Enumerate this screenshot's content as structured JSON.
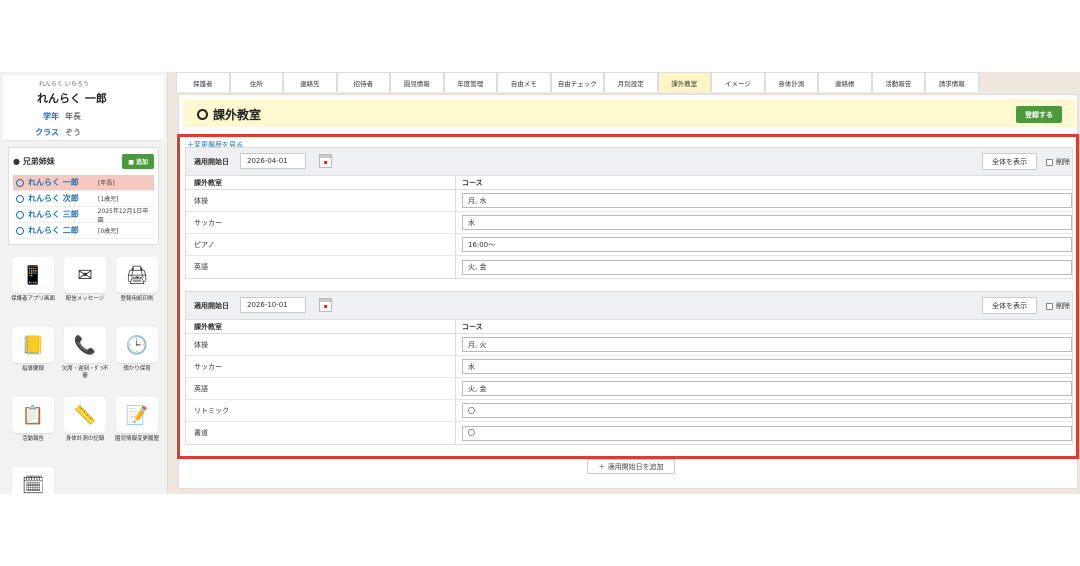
{
  "student": {
    "kana": "れんらく いちろう",
    "name": "れんらく 一郎",
    "grade_label": "学年",
    "grade_value": "年長",
    "class_label": "クラス",
    "class_value": "ぞう"
  },
  "siblings": {
    "title": "兄弟姉妹",
    "add_label": "追加",
    "items": [
      {
        "name": "れんらく 一郎",
        "tag": "[年長]"
      },
      {
        "name": "れんらく 次郎",
        "tag": "[1歳児]"
      },
      {
        "name": "れんらく 三郎",
        "tag": "2025年12月1日卒園"
      },
      {
        "name": "れんらく 二郎",
        "tag": "[0歳児]"
      }
    ]
  },
  "menu": [
    {
      "label": "保護者アプリ画面",
      "icon": "smartphone-icon",
      "glyph": "📱"
    },
    {
      "label": "配信メッセージ",
      "icon": "envelope-icon",
      "glyph": "✉"
    },
    {
      "label": "登録用紙印刷",
      "icon": "printer-icon",
      "glyph": "🖨"
    },
    {
      "label": "指導要録",
      "icon": "notebook-icon",
      "glyph": "📒"
    },
    {
      "label": "欠席・遅刻・ﾀﾞﾖ不審",
      "icon": "phone-icon",
      "glyph": "📞"
    },
    {
      "label": "預かり保育",
      "icon": "clock-icon",
      "glyph": "🕒"
    },
    {
      "label": "活動報告",
      "icon": "clipboard-icon",
      "glyph": "📋"
    },
    {
      "label": "身体計測の記録",
      "icon": "scale-icon",
      "glyph": "📏"
    },
    {
      "label": "園児情報変更履歴",
      "icon": "history-note-icon",
      "glyph": "📝"
    },
    {
      "label": "",
      "icon": "clock-edit-icon",
      "glyph": "🗓"
    }
  ],
  "tabs": [
    "保護者",
    "住所",
    "連絡先",
    "招待者",
    "園児情報",
    "年度管理",
    "自由メモ",
    "自由チェック",
    "月別設定",
    "課外教室",
    "イメージ",
    "身体計測",
    "連絡帳",
    "活動報告",
    "請求情報"
  ],
  "active_tab": 9,
  "page": {
    "title": "課外教室",
    "register_label": "登録する",
    "history_link": "＋変更履歴を見る",
    "add_date_label": "＋ 適用開始日を追加"
  },
  "sections": [
    {
      "start_label": "適用開始日",
      "start_date": "2026-04-01",
      "show_all_label": "全体を表示",
      "delete_label": "削除",
      "col1": "課外教室",
      "col2": "コース",
      "rows": [
        {
          "name": "体操",
          "course": "月, 水"
        },
        {
          "name": "サッカー",
          "course": "水"
        },
        {
          "name": "ピアノ",
          "course": "16:00〜"
        },
        {
          "name": "英語",
          "course": "火, 金"
        }
      ]
    },
    {
      "start_label": "適用開始日",
      "start_date": "2026-10-01",
      "show_all_label": "全体を表示",
      "delete_label": "削除",
      "col1": "課外教室",
      "col2": "コース",
      "rows": [
        {
          "name": "体操",
          "course": "月, 火"
        },
        {
          "name": "サッカー",
          "course": "水"
        },
        {
          "name": "英語",
          "course": "火, 金"
        },
        {
          "name": "リトミック",
          "course": "〇"
        },
        {
          "name": "書道",
          "course": "〇"
        }
      ]
    }
  ],
  "colors": {
    "accent_green": "#4a9a3c",
    "highlight_red": "#e23b2e",
    "link_blue": "#1b6fb3",
    "title_bg": "#fff9d2"
  }
}
